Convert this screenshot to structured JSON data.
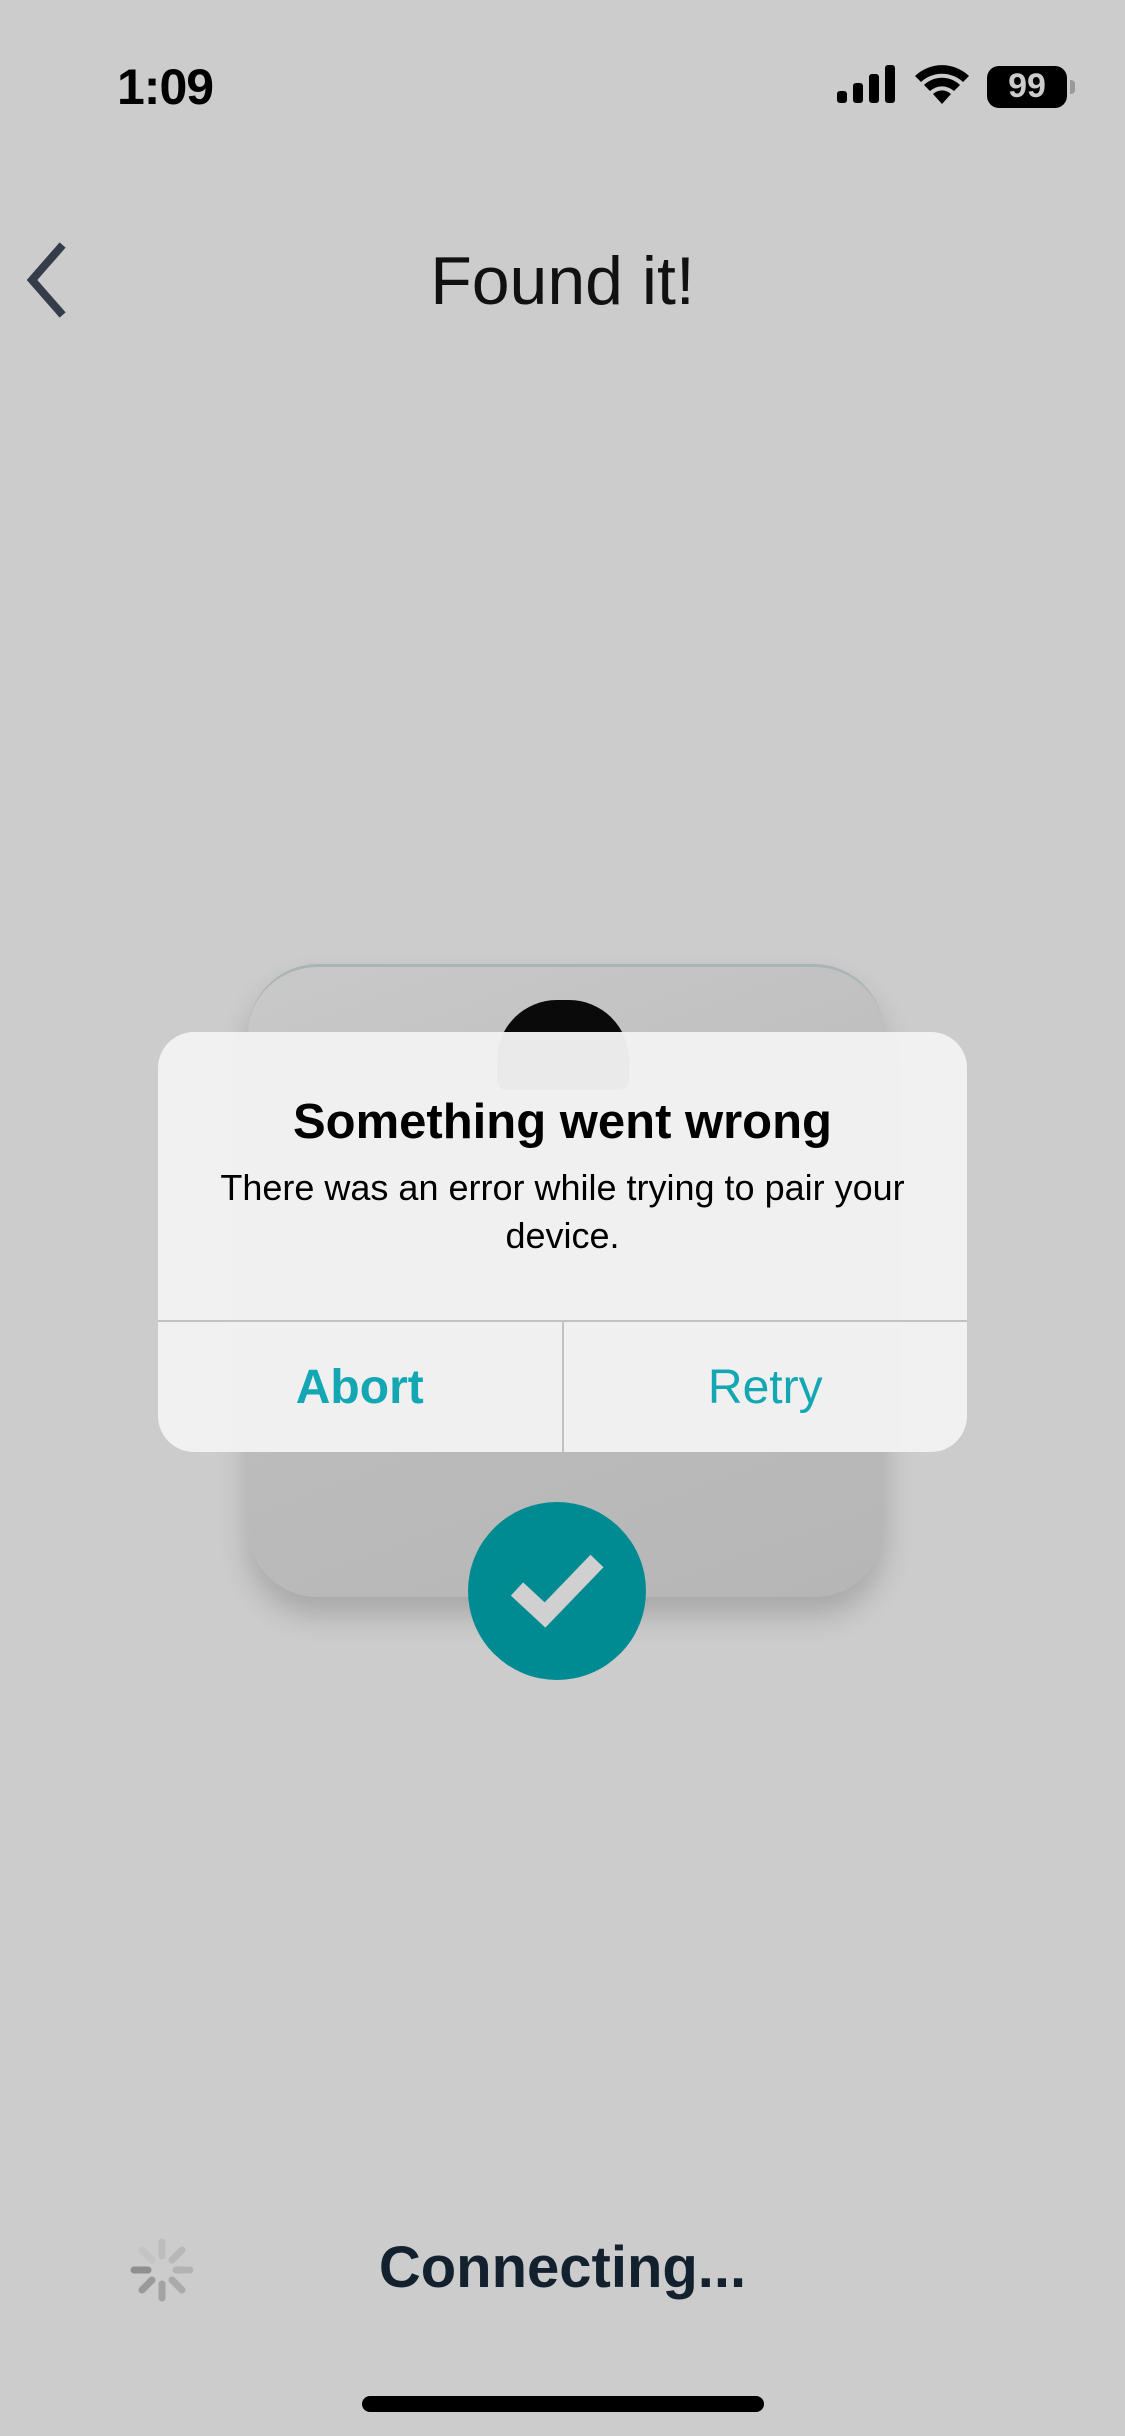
{
  "status_bar": {
    "time": "1:09",
    "signal_icon": "cellular-signal-icon",
    "wifi_icon": "wifi-icon",
    "battery_level": "99"
  },
  "nav": {
    "back_icon": "chevron-left-icon",
    "title": "Found it!"
  },
  "device": {
    "image": "smart-scale",
    "badge_icon": "checkmark-icon",
    "badge_color": "#008b92"
  },
  "alert": {
    "title": "Something went wrong",
    "message": "There was an error while trying to pair your device.",
    "actions": [
      {
        "label": "Abort",
        "style": "bold"
      },
      {
        "label": "Retry",
        "style": "regular"
      }
    ],
    "accent_color": "#13a7b4"
  },
  "footer": {
    "spinner_icon": "loading-spinner-icon",
    "status_text": "Connecting..."
  }
}
